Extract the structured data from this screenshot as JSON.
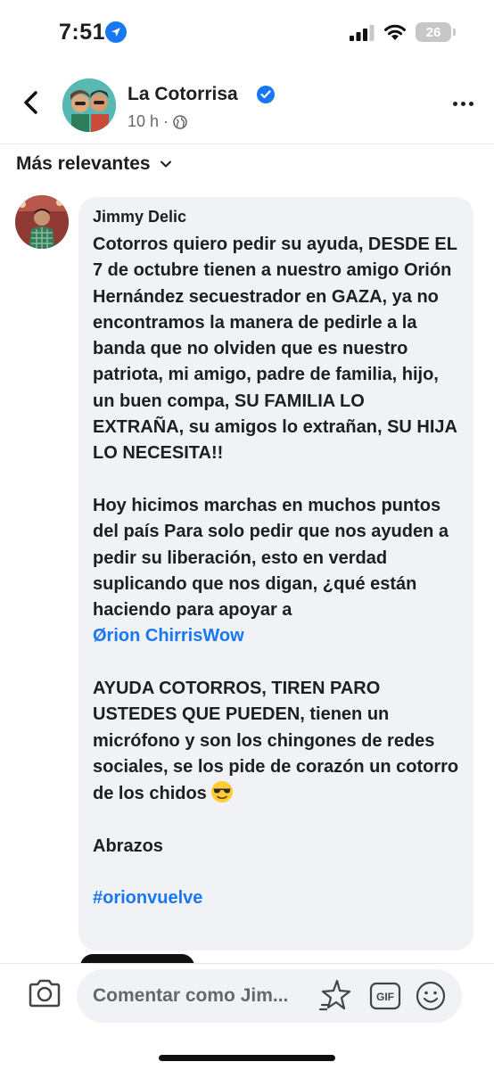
{
  "status_bar": {
    "time": "7:51",
    "battery": "26"
  },
  "header": {
    "page_name": "La Cotorrisa",
    "meta_time": "10 h",
    "meta_separator": "·"
  },
  "sort": {
    "label": "Más relevantes"
  },
  "comment": {
    "author": "Jimmy Delic",
    "paragraphs": {
      "p1": "Cotorros quiero pedir su ayuda, DESDE EL 7 de octubre tienen a nuestro amigo Orión Hernández secuestrador en GAZA, ya no encontramos la manera de pedirle a la banda que no olviden que es nuestro patriota, mi amigo, padre de familia, hijo, un buen compa, SU FAMILIA LO EXTRAÑA, su amigos lo extrañan, SU HIJA LO NECESITA!!",
      "p2": "Hoy hicimos marchas en muchos puntos del país Para solo pedir que nos ayuden a pedir su liberación, esto en verdad suplicando que nos digan, ¿qué están haciendo para apoyar a",
      "p2_link": "Ørion ChirrisWow",
      "p3": "AYUDA COTORROS, TIREN PARO USTEDES QUE PUEDEN, tienen un micrófono y son los chingones de redes sociales, se los pide de corazón un cotorro de los chidos",
      "p4": "Abrazos",
      "hashtag": "#orionvuelve"
    }
  },
  "composer": {
    "placeholder": "Comentar como Jim..."
  },
  "colors": {
    "accent": "#1877f2",
    "bubble": "#f0f2f5",
    "secondary_text": "#65676b"
  },
  "icons": [
    "location-arrow-icon",
    "signal-icon",
    "wifi-icon",
    "back-arrow-icon",
    "verified-badge-icon",
    "globe-icon",
    "more-icon",
    "chevron-down-icon",
    "sunglasses-emoji-icon",
    "camera-icon",
    "avatar-sticker-icon",
    "gif-icon",
    "smiley-icon"
  ]
}
